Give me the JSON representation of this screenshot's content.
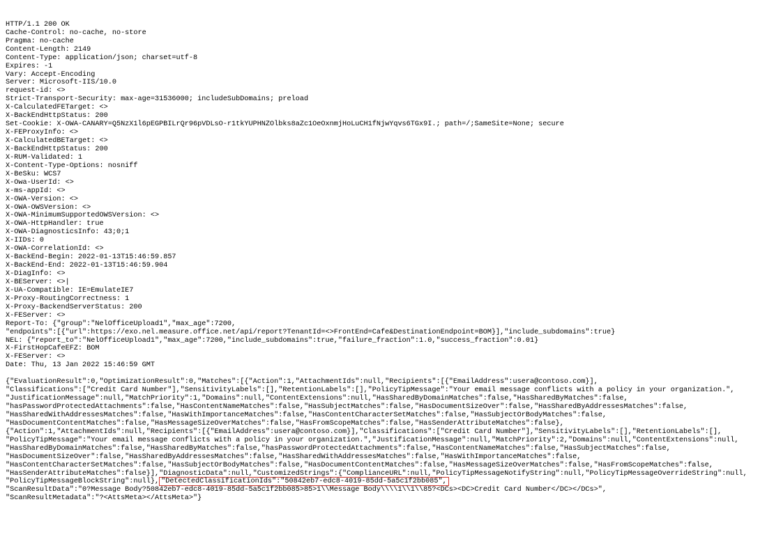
{
  "http": {
    "status_line": "HTTP/1.1 200 OK",
    "headers": {
      "cache_control": "Cache-Control: no-cache, no-store",
      "pragma": "Pragma: no-cache",
      "content_length": "Content-Length: 2149",
      "content_type": "Content-Type: application/json; charset=utf-8",
      "expires": "Expires: -1",
      "vary": "Vary: Accept-Encoding",
      "server": "Server: Microsoft-IIS/10.0",
      "request_id": "request-id: <>",
      "strict_transport_security": "Strict-Transport-Security: max-age=31536000; includeSubDomains; preload",
      "x_calculated_fe_target": "X-CalculatedFETarget: <>",
      "x_backend_http_status_1": "X-BackEndHttpStatus: 200",
      "set_cookie": "Set-Cookie: X-OWA-CANARY=Q5NzX1l6pEGPBILrQr96pVDLsO-r1tkYUPHNZOlbks8aZc1OeOxnmjHoLuCH1fNjwYqvs6TGx9I.; path=/;SameSite=None; secure",
      "x_fe_proxy_info": "X-FEProxyInfo: <>",
      "x_calculated_be_target": "X-CalculatedBETarget: <>",
      "x_backend_http_status_2": "X-BackEndHttpStatus: 200",
      "x_rum_validated": "X-RUM-Validated: 1",
      "x_content_type_options": "X-Content-Type-Options: nosniff",
      "x_besku": "X-BeSku: WCS7",
      "x_owa_userid": "X-Owa-UserId: <>",
      "x_ms_appid": "x-ms-appId: <>",
      "x_owa_version": "X-OWA-Version: <>",
      "x_owa_owsversion": "X-OWA-OWSVersion: <>",
      "x_owa_min_supported_ows": "X-OWA-MinimumSupportedOWSVersion: <>",
      "x_owa_http_handler": "X-OWA-HttpHandler: true",
      "x_owa_diagnostics_info": "X-OWA-DiagnosticsInfo: 43;0;1",
      "x_iids": "X-IIDs: 0",
      "x_owa_correlation_id": "X-OWA-CorrelationId: <>",
      "x_backend_begin": "X-BackEnd-Begin: 2022-01-13T15:46:59.857",
      "x_backend_end": "X-BackEnd-End: 2022-01-13T15:46:59.904",
      "x_diag_info": "X-DiagInfo: <>",
      "x_be_server": "X-BEServer: <>|",
      "x_ua_compatible": "X-UA-Compatible: IE=EmulateIE7",
      "x_proxy_routing_correctness": "X-Proxy-RoutingCorrectness: 1",
      "x_proxy_backend_server_status": "X-Proxy-BackendServerStatus: 200",
      "x_fe_server_1": "X-FEServer: <>",
      "report_to_line1": "Report-To: {\"group\":\"NelOfficeUpload1\",\"max_age\":7200,",
      "report_to_line2": "\"endpoints\":[{\"url\":https://exo.nel.measure.office.net/api/report?TenantId=<>FrontEnd=Cafe&DestinationEndpoint=BOM}],\"include_subdomains\":true}",
      "nel": "NEL: {\"report_to\":\"NelOfficeUpload1\",\"max_age\":7200,\"include_subdomains\":true,\"failure_fraction\":1.0,\"success_fraction\":0.01}",
      "x_first_hop_cafe_efz": "X-FirstHopCafeEFZ: BOM",
      "x_fe_server_2": "X-FEServer: <>",
      "date": "Date: Thu, 13 Jan 2022 15:46:59 GMT"
    }
  },
  "body": {
    "line1": "{\"EvaluationResult\":0,\"OptimizationResult\":0,\"Matches\":[{\"Action\":1,\"AttachmentIds\":null,\"Recipients\":[{\"EmailAddress\":usera@contoso.com}],",
    "line2": "\"Classifications\":[\"Credit Card Number\"],\"SensitivityLabels\":[],\"RetentionLabels\":[],\"PolicyTipMessage\":\"Your email message conflicts with a policy in your organization.\",",
    "line3": "\"JustificationMessage\":null,\"MatchPriority\":1,\"Domains\":null,\"ContentExtensions\":null,\"HasSharedByDomainMatches\":false,\"HasSharedByMatches\":false,",
    "line4": "\"hasPasswordProtectedAttachments\":false,\"HasContentNameMatches\":false,\"HasSubjectMatches\":false,\"HasDocumentSizeOver\":false,\"HasSharedByAddressesMatches\":false,",
    "line5": "\"HasSharedWithAddressesMatches\":false,\"HasWithImportanceMatches\":false,\"HasContentCharacterSetMatches\":false,\"HasSubjectOrBodyMatches\":false,",
    "line6": "\"HasDocumentContentMatches\":false,\"HasMessageSizeOverMatches\":false,\"HasFromScopeMatches\":false,\"HasSenderAttributeMatches\":false},",
    "line7": "{\"Action\":1,\"AttachmentIds\":null,\"Recipients\":[{\"EmailAddress\":usera@contoso.com}],\"Classifications\":[\"Credit Card Number\"],\"SensitivityLabels\":[],\"RetentionLabels\":[],",
    "line8": "\"PolicyTipMessage\":\"Your email message conflicts with a policy in your organization.\",\"JustificationMessage\":null,\"MatchPriority\":2,\"Domains\":null,\"ContentExtensions\":null,",
    "line9": "\"HasSharedByDomainMatches\":false,\"HasSharedByMatches\":false,\"hasPasswordProtectedAttachments\":false,\"HasContentNameMatches\":false,\"HasSubjectMatches\":false,",
    "line10": "\"HasDocumentSizeOver\":false,\"HasSharedByAddressesMatches\":false,\"HasSharedWithAddressesMatches\":false,\"HasWithImportanceMatches\":false,",
    "line11": "\"HasContentCharacterSetMatches\":false,\"HasSubjectOrBodyMatches\":false,\"HasDocumentContentMatches\":false,\"HasMessageSizeOverMatches\":false,\"HasFromScopeMatches\":false,",
    "line12a": "\"HasSenderAttributeMatches\":false}],\"DiagnosticData\":null,\"CustomizedStrings\":{\"ComplianceURL\":null,\"PolicyTipMessageNotifyString\":null,\"PolicyTipMessageOverrideString\":null,\n\"PolicyTipMessageBlockString\":null},",
    "highlight": "\"DetectedClassificationIds\":\"50842eb7-edc8-4019-85dd-5a5c1f2bb085\",",
    "line13": "\"ScanResultData\":\"0?Message Body?50842eb7-edc8-4019-85dd-5a5c1f2bb085>85>1\\\\Message Body\\\\\\\\1\\\\1\\\\85?<DCs><DC>Credit Card Number</DC></DCs>\",\n\"ScanResultMetadata\":\"?<AttsMeta></AttsMeta>\"}"
  }
}
